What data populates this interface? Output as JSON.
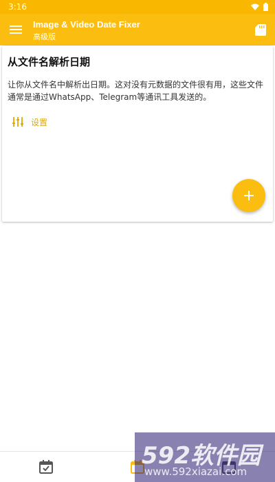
{
  "status": {
    "time": "3:16"
  },
  "app_bar": {
    "title": "Image & Video Date Fixer",
    "subtitle": "高级版"
  },
  "card": {
    "title": "从文件名解析日期",
    "description": "让你从文件名中解析出日期。这对没有元数据的文件很有用，这些文件通常是通过WhatsApp、Telegram等通讯工具发送的。",
    "settings_label": "设置"
  },
  "watermark": {
    "text": "592软件园",
    "url": "www.592xiazai.com"
  },
  "colors": {
    "primary": "#fbbd10",
    "status_bar": "#f9b700",
    "accent_text": "#e0a800"
  },
  "icons": [
    "menu-icon",
    "sd-card-icon",
    "sliders-icon",
    "plus-icon",
    "calendar-check-icon",
    "calendar-icon",
    "calendar-grid-icon"
  ]
}
